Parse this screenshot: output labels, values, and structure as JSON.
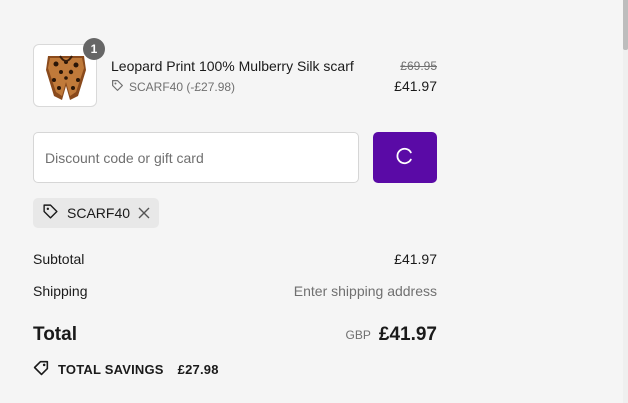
{
  "line_item": {
    "quantity": "1",
    "title": "Leopard Print 100% Mulberry Silk scarf",
    "discount_label": "SCARF40 (-£27.98)",
    "original_price": "£69.95",
    "price": "£41.97",
    "image_icon": "leopard-scarf-thumbnail"
  },
  "discount": {
    "placeholder": "Discount code or gift card",
    "value": "",
    "apply_state": "loading",
    "apply_icon": "spinner-icon",
    "applied_code": "SCARF40",
    "remove_icon": "close-icon"
  },
  "summary": {
    "subtotal_label": "Subtotal",
    "subtotal_value": "£41.97",
    "shipping_label": "Shipping",
    "shipping_value": "Enter shipping address",
    "total_label": "Total",
    "currency": "GBP",
    "total_value": "£41.97",
    "savings_label": "TOTAL SAVINGS",
    "savings_value": "£27.98"
  },
  "colors": {
    "accent": "#5a0aa6",
    "background": "#f5f5f5",
    "badge": "#666666",
    "muted_text": "#707070"
  }
}
